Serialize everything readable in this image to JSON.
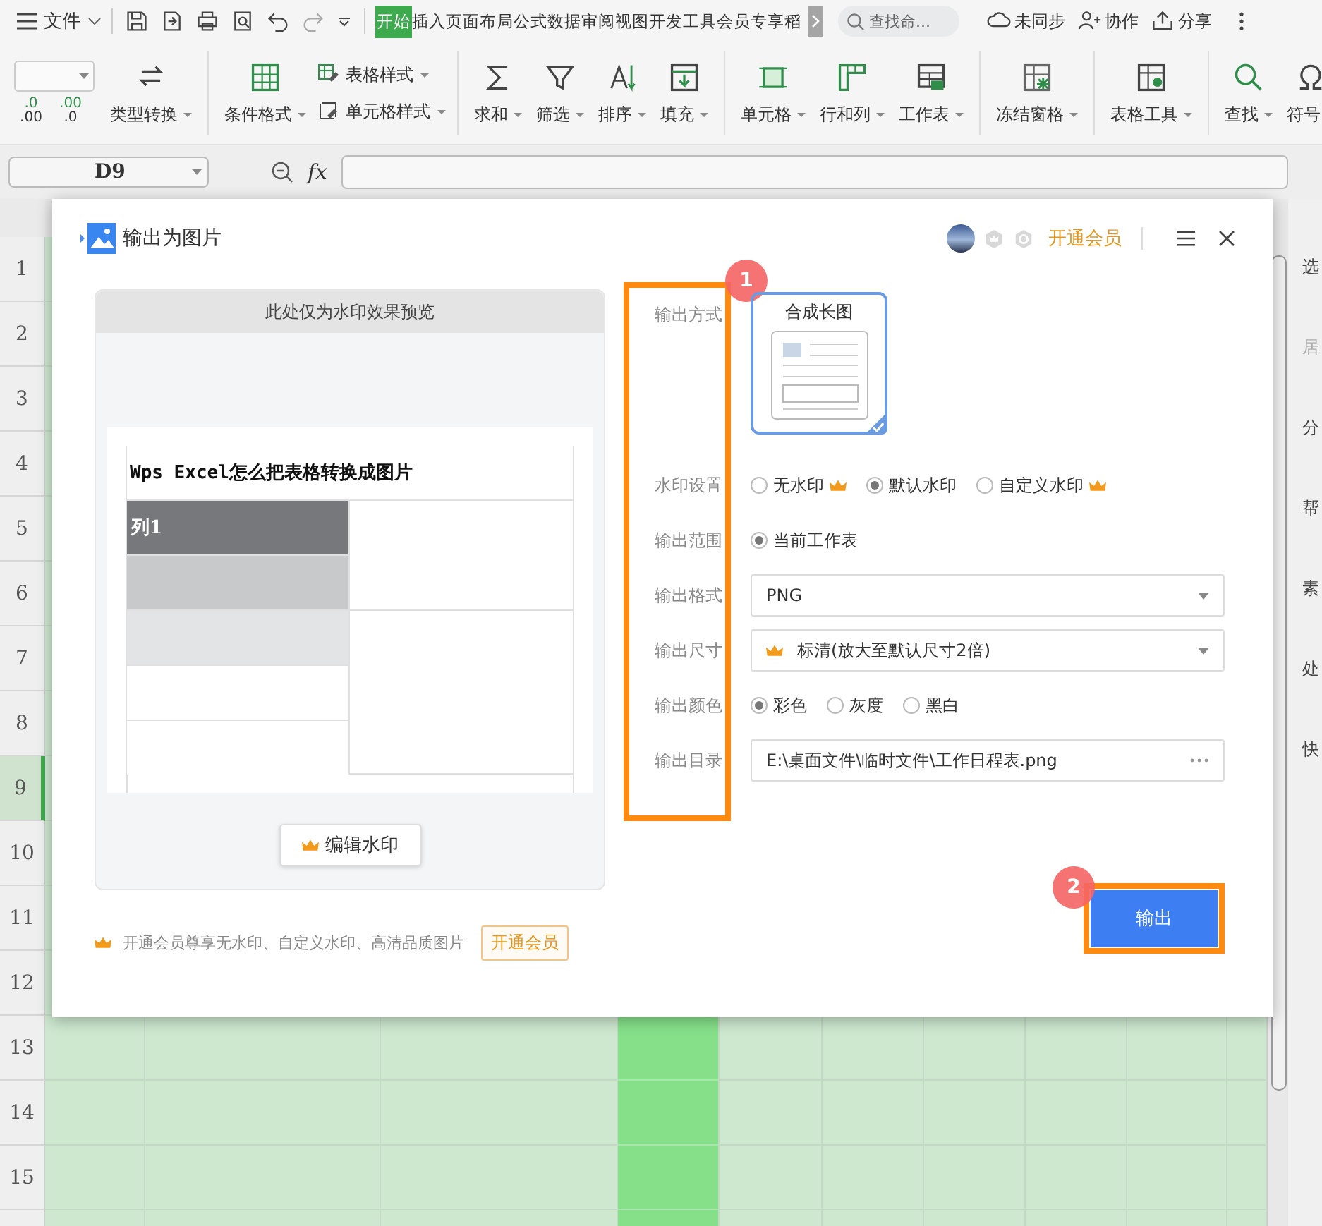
{
  "menu_bar": {
    "file_menu": "文件",
    "tabs": [
      {
        "label": "开始",
        "selected": true
      },
      {
        "label": "插入",
        "selected": false
      },
      {
        "label": "页面布局",
        "selected": false
      },
      {
        "label": "公式",
        "selected": false
      },
      {
        "label": "数据",
        "selected": false
      },
      {
        "label": "审阅",
        "selected": false
      },
      {
        "label": "视图",
        "selected": false
      },
      {
        "label": "开发工具",
        "selected": false
      },
      {
        "label": "会员专享",
        "selected": false
      },
      {
        "label": "稻",
        "selected": false
      }
    ],
    "search": {
      "placeholder": "查找命..."
    },
    "actions": [
      {
        "kind": "cloud",
        "label": "未同步"
      },
      {
        "kind": "collab",
        "label": "协作"
      },
      {
        "kind": "share",
        "label": "分享"
      }
    ]
  },
  "ribbon": {
    "decimal_buttons": [
      {
        "top": ".0",
        "bottom": ".00"
      },
      {
        "top": ".00",
        "bottom": ".0"
      }
    ],
    "groups": [
      {
        "items": [
          {
            "kind": "convert",
            "label": "类型转换"
          }
        ]
      },
      {
        "items": [
          {
            "kind": "cond",
            "label": "条件格式"
          }
        ],
        "stack": [
          {
            "kind": "tablestyle",
            "label": "表格样式"
          },
          {
            "kind": "cellstyle",
            "label": "单元格样式"
          }
        ]
      },
      {
        "items": [
          {
            "kind": "sum",
            "label": "求和"
          },
          {
            "kind": "filter",
            "label": "筛选"
          },
          {
            "kind": "sort",
            "label": "排序"
          },
          {
            "kind": "fill",
            "label": "填充"
          }
        ]
      },
      {
        "items": [
          {
            "kind": "cell",
            "label": "单元格"
          },
          {
            "kind": "rowcol",
            "label": "行和列"
          },
          {
            "kind": "sheet",
            "label": "工作表"
          }
        ]
      },
      {
        "items": [
          {
            "kind": "freeze",
            "label": "冻结窗格"
          }
        ]
      },
      {
        "items": [
          {
            "kind": "tools",
            "label": "表格工具"
          }
        ]
      },
      {
        "items": [
          {
            "kind": "find",
            "label": "查找"
          },
          {
            "kind": "symbol",
            "label": "符号"
          }
        ]
      }
    ]
  },
  "formula_bar": {
    "name_box": "D9",
    "fx": "fx"
  },
  "sheet": {
    "rows": [
      {
        "label": "1",
        "selected": false
      },
      {
        "label": "2",
        "selected": false
      },
      {
        "label": "3",
        "selected": false
      },
      {
        "label": "4",
        "selected": false
      },
      {
        "label": "5",
        "selected": false
      },
      {
        "label": "6",
        "selected": false
      },
      {
        "label": "7",
        "selected": false
      },
      {
        "label": "8",
        "selected": false
      },
      {
        "label": "9",
        "selected": true
      },
      {
        "label": "10",
        "selected": false
      },
      {
        "label": "11",
        "selected": false
      },
      {
        "label": "12",
        "selected": false
      },
      {
        "label": "13",
        "selected": false
      },
      {
        "label": "14",
        "selected": false
      },
      {
        "label": "15",
        "selected": false
      }
    ]
  },
  "side_panel": [
    "选",
    "居",
    "分",
    "帮",
    "素",
    "处",
    "快"
  ],
  "dialog": {
    "title": "输出为图片",
    "vip_link": "开通会员",
    "preview": {
      "header": "此处仅为水印效果预览",
      "document_title": "Wps Excel怎么把表格转换成图片",
      "column_header": "列1",
      "edit_button": "编辑水印"
    },
    "promo": {
      "text": "开通会员尊享无水印、自定义水印、高清品质图片",
      "button": "开通会员"
    },
    "settings": [
      {
        "label": "输出方式",
        "kind": "cards",
        "options": [
          {
            "label": "合成长图",
            "selected": true
          }
        ]
      },
      {
        "label": "水印设置",
        "kind": "radio",
        "options": [
          {
            "label": "无水印",
            "selected": false,
            "premium": true
          },
          {
            "label": "默认水印",
            "selected": true,
            "premium": false
          },
          {
            "label": "自定义水印",
            "selected": false,
            "premium": true
          }
        ]
      },
      {
        "label": "输出范围",
        "kind": "radio",
        "options": [
          {
            "label": "当前工作表",
            "selected": true
          }
        ]
      },
      {
        "label": "输出格式",
        "kind": "select",
        "value": "PNG"
      },
      {
        "label": "输出尺寸",
        "kind": "select",
        "value": "标清(放大至默认尺寸2倍)",
        "premium": true
      },
      {
        "label": "输出颜色",
        "kind": "radio",
        "options": [
          {
            "label": "彩色",
            "selected": true
          },
          {
            "label": "灰度",
            "selected": false
          },
          {
            "label": "黑白",
            "selected": false
          }
        ]
      },
      {
        "label": "输出目录",
        "kind": "path",
        "value": "E:\\桌面文件\\临时文件\\工作日程表.png"
      }
    ],
    "output_button": "输出",
    "annotations": [
      "1",
      "2"
    ]
  }
}
